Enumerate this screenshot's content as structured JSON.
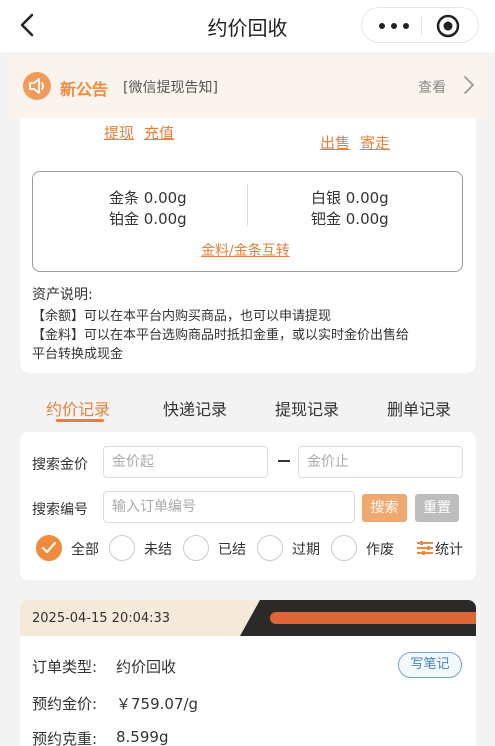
{
  "nav": {
    "title": "约价回收"
  },
  "notice": {
    "title": "新公告",
    "text": "[微信提现告知]",
    "view_label": "查看"
  },
  "assets": {
    "withdraw_label": "提现",
    "recharge_label": "充值",
    "sell_label": "出售",
    "mail_label": "寄走",
    "gold_bar": "金条 0.00g",
    "platinum": "铂金 0.00g",
    "silver": "白银 0.00g",
    "palladium": "钯金 0.00g",
    "transfer_label": "金料/金条互转",
    "desc_title": "资产说明:",
    "desc_lines": [
      "【余额】可以在本平台内购买商品，也可以申请提现",
      "【金料】可以在本平台选购商品时抵扣金重，或以实时金价出售给",
      "平台转换成现金"
    ]
  },
  "tabs": [
    "约价记录",
    "快递记录",
    "提现记录",
    "删单记录"
  ],
  "search": {
    "price_label": "搜索金价",
    "price_from_placeholder": "金价起",
    "price_to_placeholder": "金价止",
    "number_label": "搜索编号",
    "number_placeholder": "输入订单编号",
    "search_button": "搜索",
    "reset_button": "重置",
    "filters": [
      "全部",
      "未结",
      "已结",
      "过期",
      "作废"
    ],
    "stats_label": "统计"
  },
  "order": {
    "datetime": "2025-04-15 20:04:33",
    "type_label": "订单类型:",
    "type_value": "约价回收",
    "price_label": "预约金价:",
    "price_value": "￥759.07/g",
    "weight_label": "预约克重:",
    "weight_value": "8.599g",
    "note_button": "写笔记"
  },
  "colors": {
    "accent": "#f08a3c",
    "link": "#e87f3a",
    "note_blue": "#3f86c4"
  }
}
